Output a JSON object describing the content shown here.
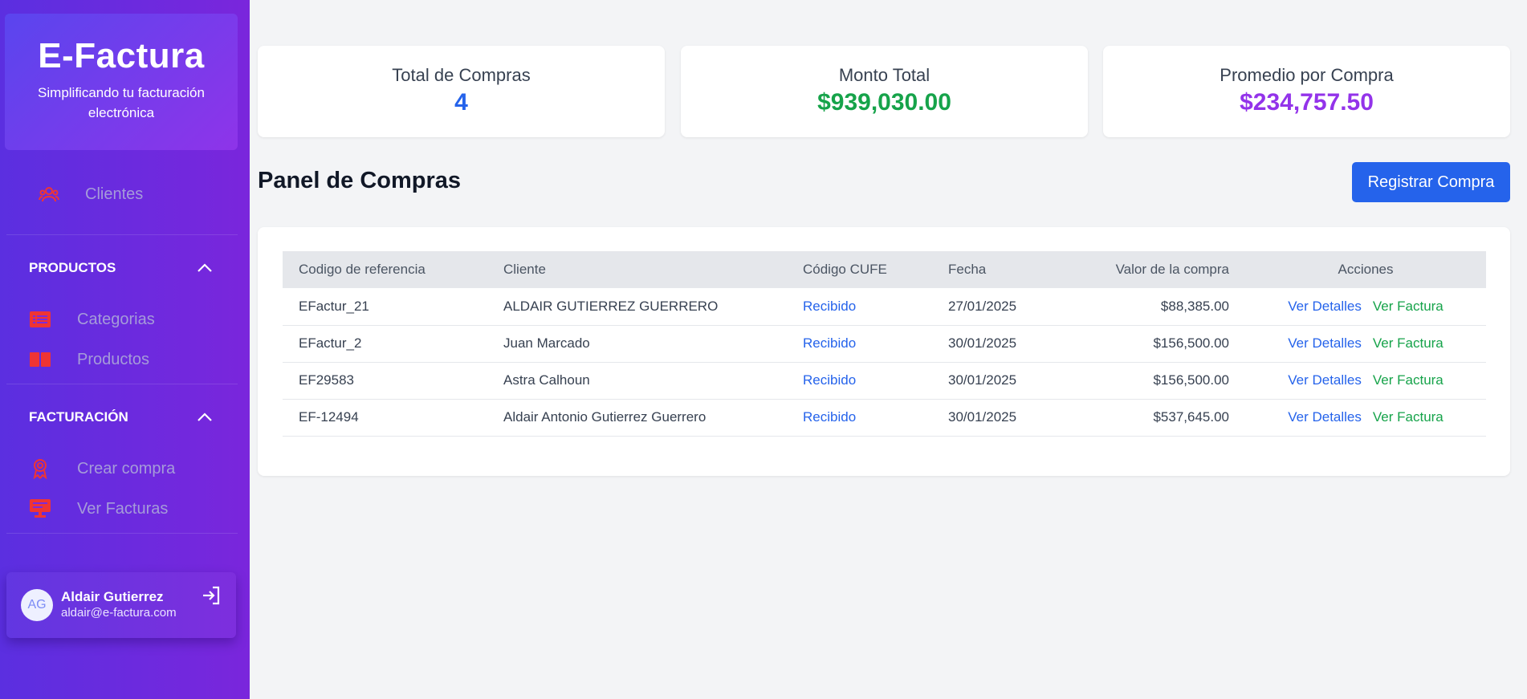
{
  "brand": {
    "title": "E-Factura",
    "subtitle": "Simplificando tu facturación electrónica"
  },
  "sidebar": {
    "clientes": {
      "label": "Clientes",
      "icon": "users-icon"
    },
    "productos_section": {
      "title": "PRODUCTOS",
      "items": [
        {
          "label": "Categorias",
          "icon": "list-icon"
        },
        {
          "label": "Productos",
          "icon": "book-icon"
        }
      ]
    },
    "facturacion_section": {
      "title": "FACTURACIÓN",
      "items": [
        {
          "label": "Crear compra",
          "icon": "badge-icon"
        },
        {
          "label": "Ver Facturas",
          "icon": "monitor-icon"
        }
      ]
    },
    "user": {
      "initials": "AG",
      "name": "Aldair Gutierrez",
      "email": "aldair@e-factura.com"
    }
  },
  "stats": [
    {
      "label": "Total de Compras",
      "value": "4",
      "color": "#2563eb"
    },
    {
      "label": "Monto Total",
      "value": "$939,030.00",
      "color": "#16a34a"
    },
    {
      "label": "Promedio por Compra",
      "value": "$234,757.50",
      "color": "#9333ea"
    }
  ],
  "main": {
    "title": "Panel de Compras",
    "register_button": "Registrar Compra"
  },
  "table": {
    "headers": [
      "Codigo de referencia",
      "Cliente",
      "Código CUFE",
      "Fecha",
      "Valor de la compra",
      "Acciones"
    ],
    "rows": [
      {
        "ref": "EFactur_21",
        "client": "ALDAIR GUTIERREZ GUERRERO",
        "cufe": "Recibido",
        "date": "27/01/2025",
        "amount": "$88,385.00"
      },
      {
        "ref": "EFactur_2",
        "client": "Juan Marcado",
        "cufe": "Recibido",
        "date": "30/01/2025",
        "amount": "$156,500.00"
      },
      {
        "ref": "EF29583",
        "client": "Astra Calhoun",
        "cufe": "Recibido",
        "date": "30/01/2025",
        "amount": "$156,500.00"
      },
      {
        "ref": "EF-12494",
        "client": "Aldair Antonio Gutierrez Guerrero",
        "cufe": "Recibido",
        "date": "30/01/2025",
        "amount": "$537,645.00"
      }
    ],
    "action_details": "Ver Detalles",
    "action_invoice": "Ver Factura"
  }
}
